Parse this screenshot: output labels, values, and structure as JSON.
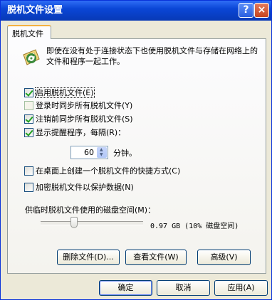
{
  "window": {
    "title": "脱机文件设置",
    "help_button": "?",
    "close_button": "×"
  },
  "tab": {
    "label": "脱机文件"
  },
  "description": "即使在没有处于连接状态下也使用脱机文件与存储在网络上的文件和程序一起工作。",
  "options": [
    {
      "label": "启用脱机文件(E)",
      "checked": true
    },
    {
      "label": "登录时同步所有脱机文件(Y)",
      "checked": false
    },
    {
      "label": "注销前同步所有脱机文件(S)",
      "checked": true
    },
    {
      "label": "显示提醒程序，每隔(R)：",
      "checked": true
    },
    {
      "label": "在桌面上创建一个脱机文件的快捷方式(C)",
      "checked": false
    },
    {
      "label": "加密脱机文件以保护数据(N)",
      "checked": false
    }
  ],
  "reminder": {
    "value": "60",
    "unit": "分钟。"
  },
  "disk": {
    "label": "供临时脱机文件使用的磁盘空间(M)：",
    "size_text": "0.97 GB (10% 磁盘空间)",
    "percent": 10
  },
  "panel_buttons": {
    "delete": "删除文件(D)...",
    "view": "查看文件(W)",
    "advanced": "高级(V)"
  },
  "dialog_buttons": {
    "ok": "确定",
    "cancel": "取消",
    "apply": "应用(A)"
  },
  "colors": {
    "titlebar": "#0a46d6",
    "background": "#ece9d8",
    "check": "#21a121"
  }
}
